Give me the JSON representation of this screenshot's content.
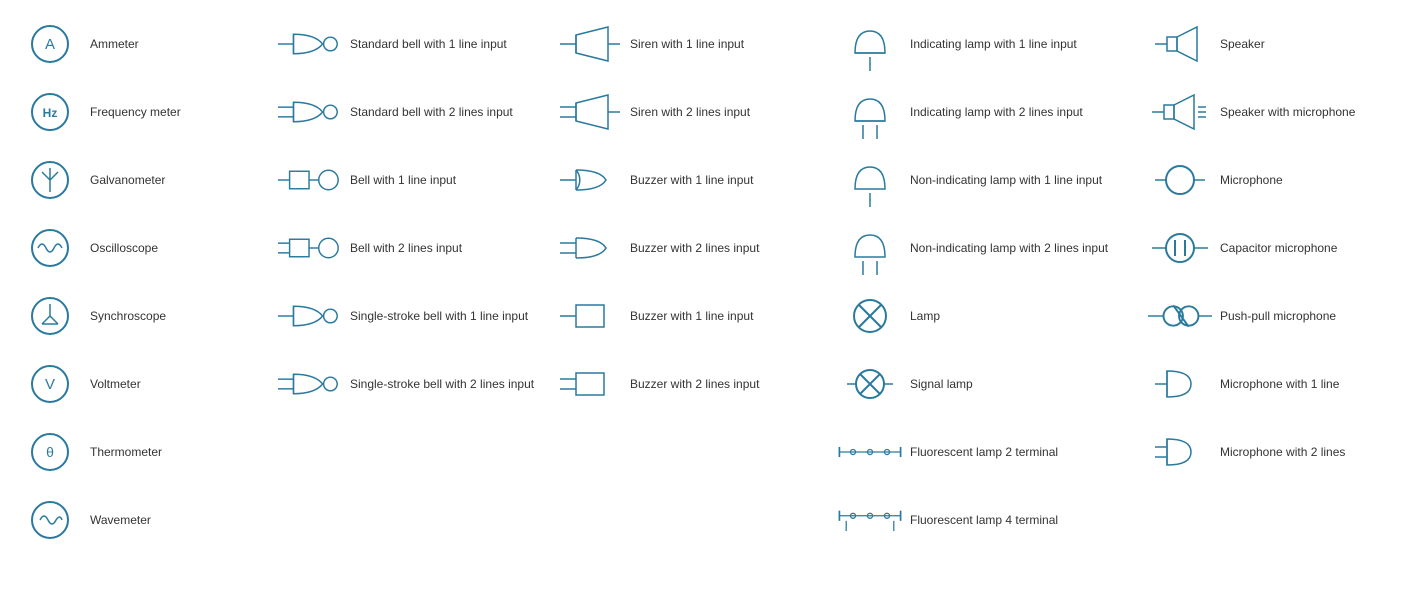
{
  "columns": [
    {
      "id": "col1",
      "items": [
        {
          "id": "ammeter",
          "label": "Ammeter",
          "symbol": "ammeter"
        },
        {
          "id": "frequency-meter",
          "label": "Frequency meter",
          "symbol": "frequency-meter"
        },
        {
          "id": "galvanometer",
          "label": "Galvanometer",
          "symbol": "galvanometer"
        },
        {
          "id": "oscilloscope",
          "label": "Oscilloscope",
          "symbol": "oscilloscope"
        },
        {
          "id": "synchroscope",
          "label": "Synchroscope",
          "symbol": "synchroscope"
        },
        {
          "id": "voltmeter",
          "label": "Voltmeter",
          "symbol": "voltmeter"
        },
        {
          "id": "thermometer",
          "label": "Thermometer",
          "symbol": "thermometer"
        },
        {
          "id": "wavemeter",
          "label": "Wavemeter",
          "symbol": "wavemeter"
        }
      ]
    },
    {
      "id": "col2",
      "items": [
        {
          "id": "std-bell-1",
          "label": "Standard bell with 1 line input",
          "symbol": "std-bell-1"
        },
        {
          "id": "std-bell-2",
          "label": "Standard bell with 2 lines input",
          "symbol": "std-bell-2"
        },
        {
          "id": "bell-1",
          "label": "Bell with 1 line input",
          "symbol": "bell-1"
        },
        {
          "id": "bell-2",
          "label": "Bell with 2 lines input",
          "symbol": "bell-2"
        },
        {
          "id": "single-bell-1",
          "label": "Single-stroke bell with 1 line input",
          "symbol": "single-bell-1"
        },
        {
          "id": "single-bell-2",
          "label": "Single-stroke bell with 2 lines input",
          "symbol": "single-bell-2"
        }
      ]
    },
    {
      "id": "col3",
      "items": [
        {
          "id": "siren-1",
          "label": "Siren with 1 line input",
          "symbol": "siren-1"
        },
        {
          "id": "siren-2",
          "label": "Siren with 2 lines input",
          "symbol": "siren-2"
        },
        {
          "id": "buzzer-1line",
          "label": "Buzzer with 1 line input",
          "symbol": "buzzer-1line"
        },
        {
          "id": "buzzer-2lines",
          "label": "Buzzer with 2 lines input",
          "symbol": "buzzer-2lines"
        },
        {
          "id": "buzzer-box-1",
          "label": "Buzzer with 1 line input",
          "symbol": "buzzer-box-1"
        },
        {
          "id": "buzzer-box-2",
          "label": "Buzzer with 2 lines input",
          "symbol": "buzzer-box-2"
        }
      ]
    },
    {
      "id": "col4",
      "items": [
        {
          "id": "ind-lamp-1",
          "label": "Indicating lamp with 1 line input",
          "symbol": "ind-lamp-1"
        },
        {
          "id": "ind-lamp-2",
          "label": "Indicating lamp with 2 lines input",
          "symbol": "ind-lamp-2"
        },
        {
          "id": "non-ind-lamp-1",
          "label": "Non-indicating lamp with 1 line input",
          "symbol": "non-ind-lamp-1"
        },
        {
          "id": "non-ind-lamp-2",
          "label": "Non-indicating lamp with 2 lines input",
          "symbol": "non-ind-lamp-2"
        },
        {
          "id": "lamp",
          "label": "Lamp",
          "symbol": "lamp"
        },
        {
          "id": "signal-lamp",
          "label": "Signal lamp",
          "symbol": "signal-lamp"
        },
        {
          "id": "fluor-2",
          "label": "Fluorescent lamp 2 terminal",
          "symbol": "fluor-2"
        },
        {
          "id": "fluor-4",
          "label": "Fluorescent lamp 4 terminal",
          "symbol": "fluor-4"
        }
      ]
    },
    {
      "id": "col5",
      "items": [
        {
          "id": "speaker",
          "label": "Speaker",
          "symbol": "speaker"
        },
        {
          "id": "speaker-mic",
          "label": "Speaker with microphone",
          "symbol": "speaker-mic"
        },
        {
          "id": "microphone",
          "label": "Microphone",
          "symbol": "microphone"
        },
        {
          "id": "capacitor-mic",
          "label": "Capacitor microphone",
          "symbol": "capacitor-mic"
        },
        {
          "id": "push-pull-mic",
          "label": "Push-pull microphone",
          "symbol": "push-pull-mic"
        },
        {
          "id": "mic-1line",
          "label": "Microphone with 1 line",
          "symbol": "mic-1line"
        },
        {
          "id": "mic-2lines",
          "label": "Microphone with 2 lines",
          "symbol": "mic-2lines"
        }
      ]
    }
  ]
}
